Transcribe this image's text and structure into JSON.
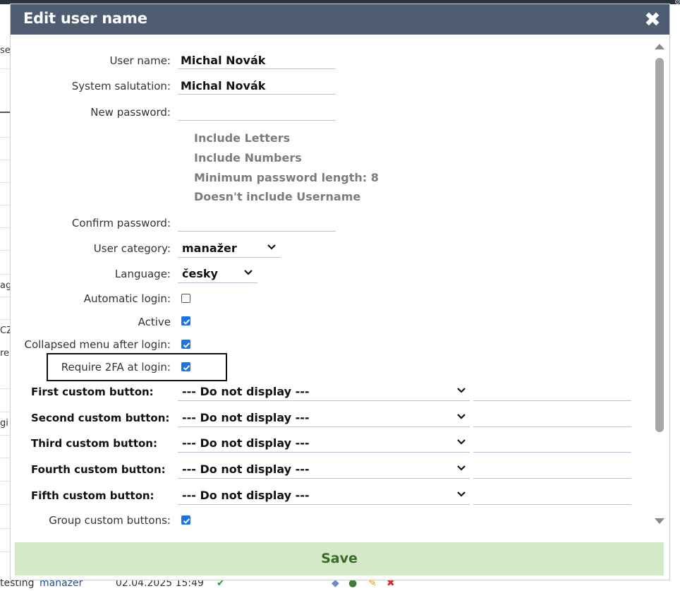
{
  "background": {
    "fragments": [
      "se",
      "ag",
      "CZ",
      "re",
      "gi"
    ],
    "bottom_row": {
      "name": "testing",
      "category": "manažer",
      "date": "02.04.2025 15:49",
      "check": "✔"
    },
    "gear_glyph": "⚙"
  },
  "dialog": {
    "title": "Edit user name",
    "close_glyph": "✖",
    "fields": {
      "user_name": {
        "label": "User name:",
        "value": "Michal Novák"
      },
      "system_salutation": {
        "label": "System salutation:",
        "value": "Michal Novák"
      },
      "new_password": {
        "label": "New password:",
        "value": ""
      },
      "confirm_password": {
        "label": "Confirm password:",
        "value": ""
      },
      "user_category": {
        "label": "User category:",
        "value": "manažer"
      },
      "language": {
        "label": "Language:",
        "value": "česky"
      },
      "automatic_login": {
        "label": "Automatic login:",
        "checked": false
      },
      "active": {
        "label": "Active",
        "checked": true
      },
      "collapsed_menu": {
        "label": "Collapsed menu after login:",
        "checked": true
      },
      "require_2fa": {
        "label": "Require 2FA at login:",
        "checked": true
      },
      "group_custom_buttons": {
        "label": "Group custom buttons:",
        "checked": true
      }
    },
    "password_rules": [
      "Include Letters",
      "Include Numbers",
      "Minimum password length: 8",
      "Doesn't include Username"
    ],
    "custom_buttons": [
      {
        "label": "First custom button:",
        "value": "--- Do not display ---"
      },
      {
        "label": "Second custom button:",
        "value": "--- Do not display ---"
      },
      {
        "label": "Third custom button:",
        "value": "--- Do not display ---"
      },
      {
        "label": "Fourth custom button:",
        "value": "--- Do not display ---"
      },
      {
        "label": "Fifth custom button:",
        "value": "--- Do not display ---"
      }
    ],
    "save_label": "Save"
  },
  "colors": {
    "header": "#4e5d72",
    "save_bg": "#d4e9c8",
    "save_text": "#3a6a28",
    "checkbox": "#1a73e8"
  }
}
